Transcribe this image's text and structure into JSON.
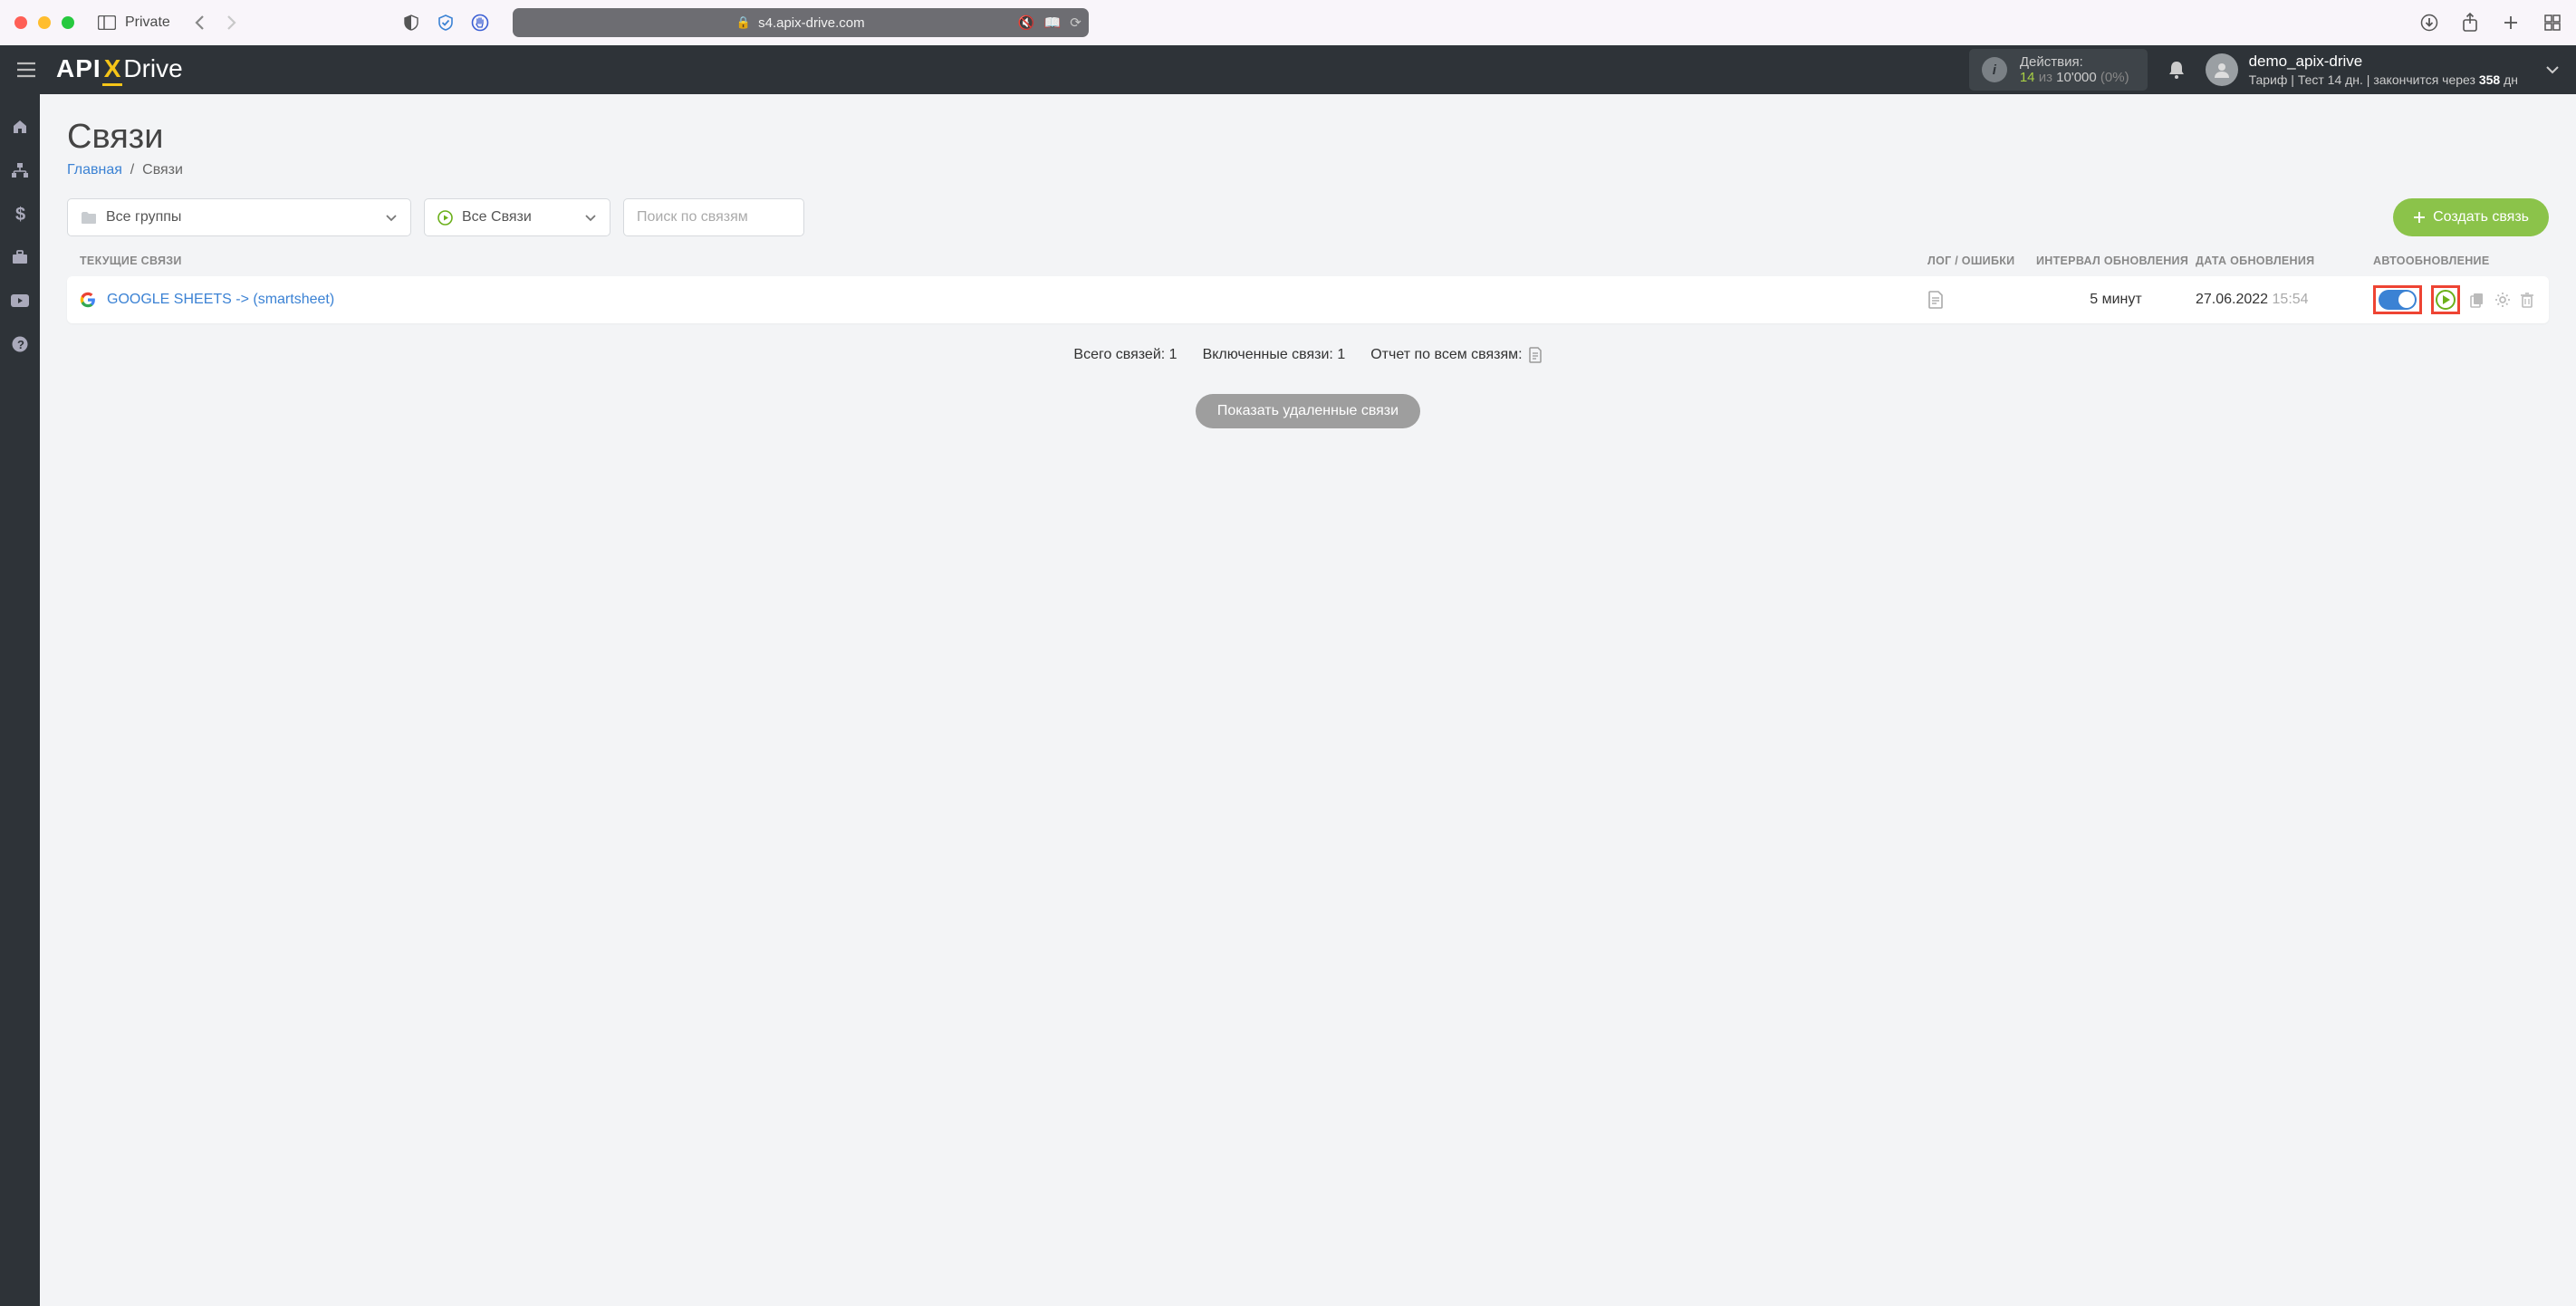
{
  "browser": {
    "private_label": "Private",
    "url_host": "s4.apix-drive.com"
  },
  "header": {
    "actions_label": "Действия:",
    "actions_count": "14",
    "actions_of": "из",
    "actions_total": "10'000",
    "actions_pct": "(0%)",
    "username": "demo_apix-drive",
    "tariff_prefix": "Тариф  | Тест 14 дн. |  закончится через",
    "tariff_days": "358",
    "tariff_suffix": "дн"
  },
  "page": {
    "title": "Связи",
    "breadcrumb_home": "Главная",
    "breadcrumb_sep": "/",
    "breadcrumb_current": "Связи"
  },
  "controls": {
    "groups_label": "Все группы",
    "connections_label": "Все Связи",
    "search_placeholder": "Поиск по связям",
    "create_label": "Создать связь"
  },
  "table": {
    "headers": {
      "current": "ТЕКУЩИЕ СВЯЗИ",
      "log": "ЛОГ / ОШИБКИ",
      "interval": "ИНТЕРВАЛ ОБНОВЛЕНИЯ",
      "date": "ДАТА ОБНОВЛЕНИЯ",
      "auto": "АВТООБНОВЛЕНИЕ"
    },
    "rows": [
      {
        "name": "GOOGLE SHEETS -> (smartsheet)",
        "interval": "5 минут",
        "date": "27.06.2022",
        "time": "15:54"
      }
    ]
  },
  "summary": {
    "total_label": "Всего связей:",
    "total_value": "1",
    "enabled_label": "Включенные связи:",
    "enabled_value": "1",
    "report_label": "Отчет по всем связям:"
  },
  "buttons": {
    "show_deleted": "Показать удаленные связи"
  }
}
